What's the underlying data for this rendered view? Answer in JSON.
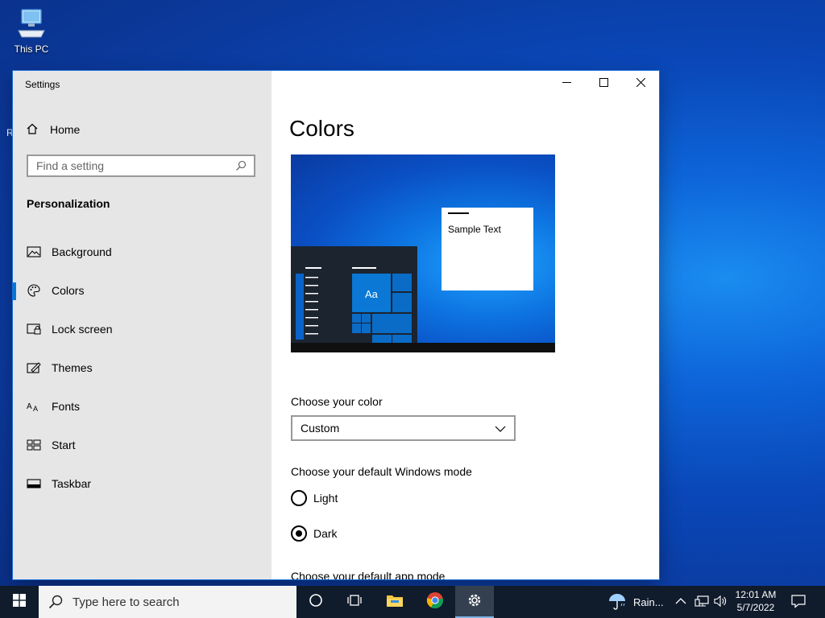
{
  "desktop": {
    "icons": [
      {
        "label": "This PC",
        "icon": "computer-icon"
      }
    ],
    "edge_text": "R"
  },
  "window": {
    "title": "Settings",
    "controls": [
      "minimize",
      "maximize",
      "close"
    ]
  },
  "sidebar": {
    "home_label": "Home",
    "search_placeholder": "Find a setting",
    "section_title": "Personalization",
    "items": [
      {
        "label": "Background",
        "icon": "picture-icon",
        "active": false
      },
      {
        "label": "Colors",
        "icon": "palette-icon",
        "active": true
      },
      {
        "label": "Lock screen",
        "icon": "lock-screen-icon",
        "active": false
      },
      {
        "label": "Themes",
        "icon": "themes-icon",
        "active": false
      },
      {
        "label": "Fonts",
        "icon": "fonts-icon",
        "active": false
      },
      {
        "label": "Start",
        "icon": "start-icon",
        "active": false
      },
      {
        "label": "Taskbar",
        "icon": "taskbar-icon",
        "active": false
      }
    ]
  },
  "content": {
    "title": "Colors",
    "preview": {
      "sample_text": "Sample Text",
      "tile_text": "Aa"
    },
    "choose_color_label": "Choose your color",
    "choose_color_value": "Custom",
    "windows_mode_label": "Choose your default Windows mode",
    "windows_mode_options": [
      {
        "label": "Light",
        "selected": false
      },
      {
        "label": "Dark",
        "selected": true
      }
    ],
    "app_mode_label": "Choose your default app mode"
  },
  "taskbar": {
    "search_placeholder": "Type here to search",
    "apps": [
      "cortana-icon",
      "task-view-icon",
      "file-explorer-icon",
      "chrome-icon",
      "settings-icon"
    ],
    "active_app": "settings-icon",
    "weather_text": "Rain...",
    "time": "12:01 AM",
    "date": "5/7/2022"
  },
  "colors": {
    "accent": "#0078d7",
    "sidebar_bg": "#e6e6e6",
    "taskbar_bg": "#101b2c"
  }
}
